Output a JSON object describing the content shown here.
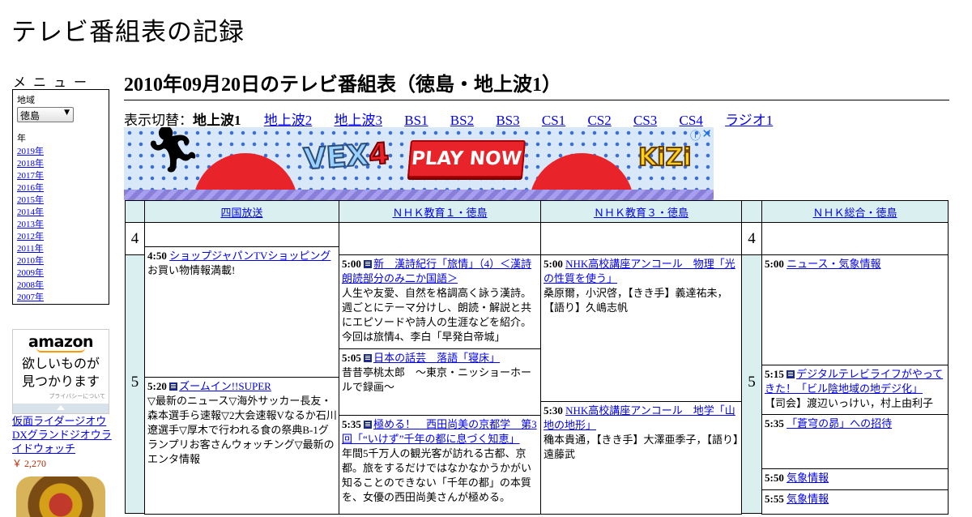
{
  "site": {
    "title": "テレビ番組表の記録"
  },
  "sidebar": {
    "menu_title": "メニュー",
    "region_label": "地域",
    "region_value": "徳島",
    "year_label": "年",
    "years": [
      "2019年",
      "2018年",
      "2017年",
      "2016年",
      "2015年",
      "2014年",
      "2013年",
      "2012年",
      "2011年",
      "2010年",
      "2009年",
      "2008年",
      "2007年"
    ],
    "ad": {
      "logo": "amazon",
      "copy_line1": "欲しいものが",
      "copy_line2": "見つかります",
      "privacy": "プライバシーについて",
      "product_name": "仮面ライダージオウ DXグランドジオウライドウォッチ",
      "product_price": "￥ 2,270"
    }
  },
  "main": {
    "heading": "2010年09月20日のテレビ番組表（徳島・地上波1）",
    "switch_label": "表示切替：",
    "current_channel_set": "地上波1",
    "channel_sets": [
      "地上波2",
      "地上波3",
      "BS1",
      "BS2",
      "BS3",
      "CS1",
      "CS2",
      "CS3",
      "CS4",
      "ラジオ1"
    ]
  },
  "banner_ad": {
    "logo": "VEX",
    "logo_number": "4",
    "play_label": "PLAY NOW",
    "brand": "KiZi",
    "info_icon": "info-icon",
    "close_icon": "close-icon"
  },
  "schedule": {
    "channels": [
      "四国放送",
      "ＮＨＫ教育１・徳島",
      "ＮＨＫ教育３・徳島",
      "ＮＨＫ総合・徳島"
    ],
    "hours": [
      "4",
      "5"
    ],
    "programs": [
      {
        "time": "4:50",
        "title": "ショップジャパンTVショッピング",
        "desc": "お買い物情報満載!"
      },
      {
        "time": "5:20",
        "title": "ズームイン!!SUPER",
        "desc": "▽最新のニュース▽海外サッカー長友・森本選手ら速報▽2大会速報Vなるか石川遼選手▽厚木で行われる食の祭典B-1グランプリお客さんウォッチング▽最新のエンタ情報"
      },
      {
        "time": "5:00",
        "title": "新　漢詩紀行「旅情」（4）＜漢詩朗読部分のみ二か国語＞",
        "desc": "人生や友愛、自然を格調高く詠う漢詩。週ごとにテーマ分けし、朗読・解説と共にエピソードや詩人の生涯などを紹介。今回は旅情4、李白「早発白帝城」"
      },
      {
        "time": "5:05",
        "title": "日本の話芸　落語「寝床」",
        "desc": "昔昔亭桃太郎　～東京・ニッショーホールで録画～"
      },
      {
        "time": "5:35",
        "title": "極める！　西田尚美の京都学　第3回「“いけず”千年の都に息づく知恵」",
        "desc": "年間5千万人の観光客が訪れる古都、京都。旅をするだけではなかなかうかがい知ることのできない「千年の都」の本質を、女優の西田尚美さんが極める。"
      },
      {
        "time": "5:00",
        "title": "NHK高校講座アンコール　物理「光の性質を使う」",
        "desc": "桑原爾，小沢啓，【きき手】義達祐未，【語り】久嶋志帆"
      },
      {
        "time": "5:30",
        "title": "NHK高校講座アンコール　地学「山地の地形」",
        "desc": "穐本貴通，【きき手】大澤亜季子，【語り】遠藤武"
      },
      {
        "time": "5:00",
        "title": "ニュース・気象情報",
        "desc": ""
      },
      {
        "time": "5:15",
        "title": "デジタルテレビライフがやってきた！「ビル陰地域の地デジ化」",
        "desc": "【司会】渡辺いっけい，村上由利子"
      },
      {
        "time": "5:35",
        "title": "「蒼穹の昴」への招待",
        "desc": ""
      },
      {
        "time": "5:50",
        "title": "気象情報",
        "desc": ""
      },
      {
        "time": "5:55",
        "title": "気象情報",
        "desc": ""
      }
    ]
  }
}
